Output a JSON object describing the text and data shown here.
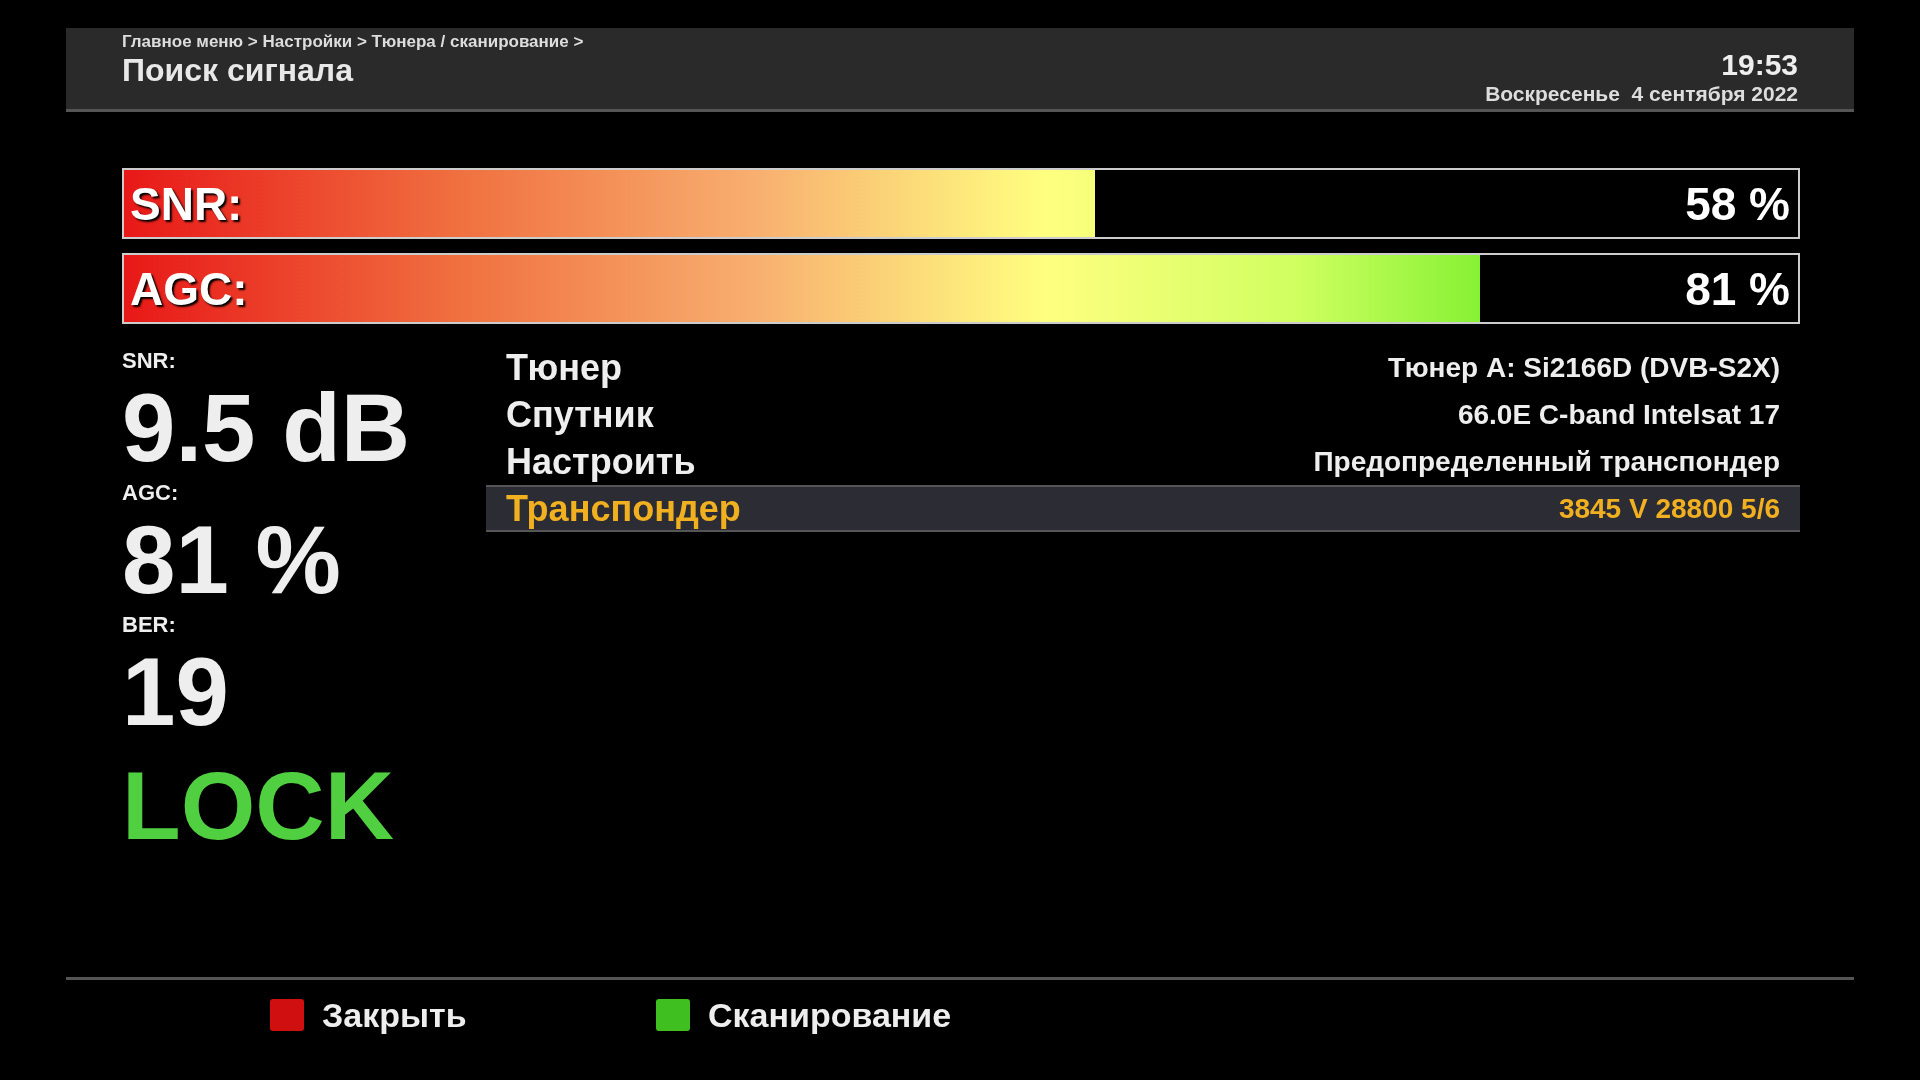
{
  "header": {
    "breadcrumb": "Главное меню > Настройки > Тюнера / сканирование >",
    "title": "Поиск сигнала",
    "time": "19:53",
    "date": "Воскресенье  4 сентября 2022"
  },
  "bars": [
    {
      "label": "SNR:",
      "level": 0.58,
      "reading": "58 %"
    },
    {
      "label": "AGC:",
      "level": 0.81,
      "reading": "81 %"
    }
  ],
  "stats": [
    {
      "label": "SNR:",
      "value": "9.5 dB"
    },
    {
      "label": "AGC:",
      "value": "81 %"
    },
    {
      "label": "BER:",
      "value": "19"
    }
  ],
  "status": "LOCK",
  "settings": [
    {
      "label": "Тюнер",
      "value": "Тюнер A: Si2166D (DVB-S2X)",
      "selected": false
    },
    {
      "label": "Спутник",
      "value": "66.0E C-band Intelsat 17",
      "selected": false
    },
    {
      "label": "Настроить",
      "value": "Предопределенный транспондер",
      "selected": false
    },
    {
      "label": "Транспондер",
      "value": "3845 V 28800 5/6",
      "selected": true
    }
  ],
  "keys": [
    {
      "label": "Закрыть",
      "color": "#d01010"
    },
    {
      "label": "Сканирование",
      "color": "#40c020"
    }
  ]
}
